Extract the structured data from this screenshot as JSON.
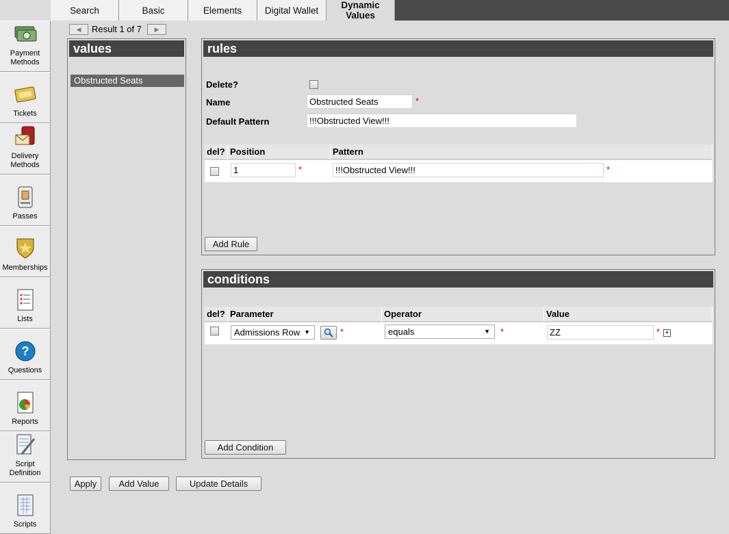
{
  "tabs": [
    {
      "label": "Search"
    },
    {
      "label": "Basic"
    },
    {
      "label": "Elements"
    },
    {
      "label": "Digital Wallet"
    },
    {
      "label": "Dynamic Values"
    }
  ],
  "sidebar": {
    "items": [
      {
        "label": "Payment Methods",
        "icon": "money-icon"
      },
      {
        "label": "Tickets",
        "icon": "ticket-icon"
      },
      {
        "label": "Delivery Methods",
        "icon": "mailbox-icon"
      },
      {
        "label": "Passes",
        "icon": "pass-icon"
      },
      {
        "label": "Memberships",
        "icon": "badge-icon"
      },
      {
        "label": "Lists",
        "icon": "list-icon"
      },
      {
        "label": "Questions",
        "icon": "question-icon"
      },
      {
        "label": "Reports",
        "icon": "report-icon"
      },
      {
        "label": "Script Definition",
        "icon": "script-definition-icon"
      },
      {
        "label": "Scripts",
        "icon": "scripts-icon"
      }
    ]
  },
  "pager": {
    "text": "Result 1 of 7",
    "prev_icon": "arrow-left-icon",
    "next_icon": "arrow-right-icon"
  },
  "values_panel": {
    "title": "values",
    "items": [
      "Obstructed Seats"
    ]
  },
  "rules_panel": {
    "title": "rules",
    "delete_label": "Delete?",
    "name_label": "Name",
    "name_value": "Obstructed Seats",
    "default_pattern_label": "Default Pattern",
    "default_pattern_value": "!!!Obstructed View!!!",
    "columns": [
      "del?",
      "Position",
      "Pattern"
    ],
    "rows": [
      {
        "position": "1",
        "pattern": "!!!Obstructed View!!!"
      }
    ],
    "add_button": "Add Rule"
  },
  "conditions_panel": {
    "title": "conditions",
    "columns": [
      "del?",
      "Parameter",
      "Operator",
      "Value"
    ],
    "rows": [
      {
        "parameter": "Admissions Row",
        "operator": "equals",
        "value": "ZZ"
      }
    ],
    "add_button": "Add Condition"
  },
  "required_marker": "*",
  "footer": {
    "apply": "Apply",
    "add_value": "Add Value",
    "update_details": "Update Details"
  }
}
